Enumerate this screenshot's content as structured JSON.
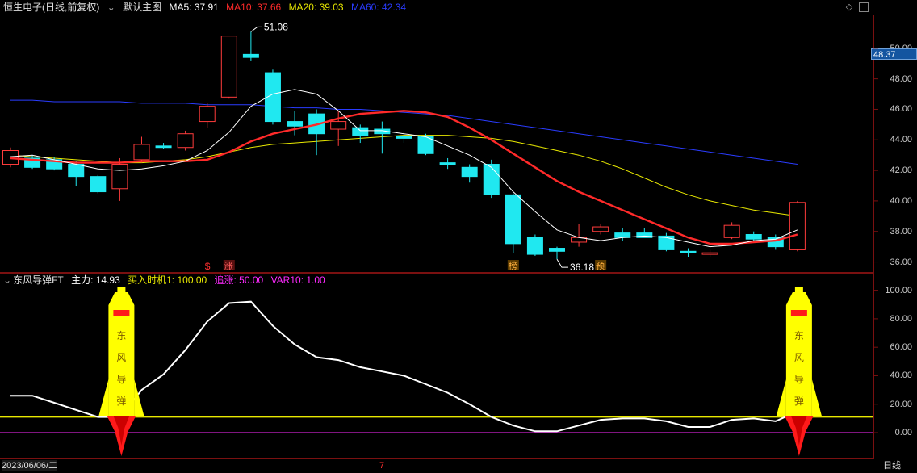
{
  "header_top": {
    "stock": "恒生电子",
    "period": "(日线,前复权)",
    "dropdown_icon": "chevron-down-icon",
    "template": "默认主图",
    "ma5": "MA5: 37.91",
    "ma10": "MA10: 37.66",
    "ma20": "MA20: 39.03",
    "ma60": "MA60: 42.34",
    "colors": {
      "stock": "#e0e0e0",
      "ma5": "#ffffff",
      "ma10": "#ff2a2a",
      "ma20": "#e8e800",
      "ma60": "#2a3cff"
    }
  },
  "header_bottom": {
    "indicator": "东风导弹FT",
    "main_force": "主力: 14.93",
    "buy_timing": "买入时机1: 100.00",
    "chase": "追涨: 50.00",
    "var10": "VAR10: 1.00",
    "colors": {
      "main_force": "#ffffff",
      "buy_timing": "#e8e800",
      "chase": "#ff2aff",
      "var10": "#ff2aff"
    }
  },
  "footer": {
    "date": "2023/06/06/二",
    "mark": "7",
    "period": "日线"
  },
  "last_price": "48.37",
  "chart_data": [
    {
      "type": "candlestick",
      "title": "恒生电子 (日线,前复权)",
      "ylim": [
        35.5,
        52
      ],
      "yticks": [
        "36.00",
        "38.00",
        "40.00",
        "42.00",
        "44.00",
        "46.00",
        "48.00",
        "50.00"
      ],
      "candles": [
        {
          "o": 42.4,
          "h": 43.5,
          "l": 42.2,
          "c": 43.3
        },
        {
          "o": 42.8,
          "h": 43.0,
          "l": 42.1,
          "c": 42.2
        },
        {
          "o": 42.7,
          "h": 42.9,
          "l": 42.0,
          "c": 42.1
        },
        {
          "o": 42.4,
          "h": 42.6,
          "l": 41.0,
          "c": 41.6
        },
        {
          "o": 41.6,
          "h": 41.7,
          "l": 40.5,
          "c": 40.6
        },
        {
          "o": 40.8,
          "h": 42.8,
          "l": 40.0,
          "c": 42.4
        },
        {
          "o": 42.7,
          "h": 44.2,
          "l": 42.5,
          "c": 43.7
        },
        {
          "o": 43.6,
          "h": 43.8,
          "l": 43.4,
          "c": 43.5
        },
        {
          "o": 43.5,
          "h": 44.6,
          "l": 43.3,
          "c": 44.4
        },
        {
          "o": 45.2,
          "h": 46.4,
          "l": 44.8,
          "c": 46.2
        },
        {
          "o": 46.8,
          "h": 50.8,
          "l": 46.7,
          "c": 50.8
        },
        {
          "o": 49.6,
          "h": 51.08,
          "l": 49.2,
          "c": 49.4
        },
        {
          "o": 48.4,
          "h": 48.6,
          "l": 45.0,
          "c": 45.2
        },
        {
          "o": 45.2,
          "h": 45.9,
          "l": 44.3,
          "c": 44.9
        },
        {
          "o": 45.7,
          "h": 46.0,
          "l": 43.0,
          "c": 44.4
        },
        {
          "o": 44.7,
          "h": 45.9,
          "l": 43.6,
          "c": 45.2
        },
        {
          "o": 44.8,
          "h": 45.0,
          "l": 43.8,
          "c": 44.3
        },
        {
          "o": 44.7,
          "h": 45.2,
          "l": 43.1,
          "c": 44.4
        },
        {
          "o": 44.2,
          "h": 44.5,
          "l": 43.8,
          "c": 44.1
        },
        {
          "o": 44.2,
          "h": 44.4,
          "l": 43.0,
          "c": 43.1
        },
        {
          "o": 42.5,
          "h": 42.8,
          "l": 42.1,
          "c": 42.4
        },
        {
          "o": 42.2,
          "h": 42.4,
          "l": 41.2,
          "c": 41.6
        },
        {
          "o": 42.4,
          "h": 42.7,
          "l": 40.2,
          "c": 40.4
        },
        {
          "o": 40.4,
          "h": 40.5,
          "l": 36.6,
          "c": 37.2
        },
        {
          "o": 37.6,
          "h": 37.8,
          "l": 36.4,
          "c": 36.5
        },
        {
          "o": 36.9,
          "h": 37.0,
          "l": 36.18,
          "c": 36.7
        },
        {
          "o": 37.3,
          "h": 38.5,
          "l": 37.0,
          "c": 37.6
        },
        {
          "o": 38.0,
          "h": 38.5,
          "l": 37.8,
          "c": 38.3
        },
        {
          "o": 37.9,
          "h": 38.2,
          "l": 37.4,
          "c": 37.6
        },
        {
          "o": 37.9,
          "h": 38.2,
          "l": 37.6,
          "c": 37.6
        },
        {
          "o": 37.7,
          "h": 37.9,
          "l": 36.7,
          "c": 36.8
        },
        {
          "o": 36.7,
          "h": 36.9,
          "l": 36.3,
          "c": 36.6
        },
        {
          "o": 36.5,
          "h": 36.8,
          "l": 36.3,
          "c": 36.6
        },
        {
          "o": 37.6,
          "h": 38.6,
          "l": 37.5,
          "c": 38.4
        },
        {
          "o": 37.8,
          "h": 38.0,
          "l": 37.4,
          "c": 37.5
        },
        {
          "o": 37.6,
          "h": 37.8,
          "l": 36.8,
          "c": 37.0
        },
        {
          "o": 36.8,
          "h": 40.0,
          "l": 36.7,
          "c": 39.9
        }
      ],
      "series": [
        {
          "name": "MA5",
          "color": "#ffffff",
          "values": [
            42.9,
            43.0,
            42.7,
            42.4,
            42.1,
            42.0,
            42.1,
            42.3,
            42.6,
            43.3,
            44.5,
            46.2,
            47.0,
            47.3,
            47.0,
            45.9,
            44.6,
            44.6,
            44.4,
            44.2,
            43.6,
            43.0,
            42.2,
            40.6,
            39.3,
            38.1,
            37.6,
            37.4,
            37.6,
            37.7,
            37.6,
            37.3,
            37.0,
            37.1,
            37.4,
            37.5,
            38.1
          ]
        },
        {
          "name": "MA10",
          "color": "#ff2a2a",
          "values": [
            42.8,
            42.7,
            42.6,
            42.5,
            42.5,
            42.5,
            42.6,
            42.6,
            42.6,
            42.7,
            43.2,
            43.9,
            44.4,
            44.7,
            45.0,
            45.4,
            45.7,
            45.8,
            45.9,
            45.8,
            45.5,
            44.8,
            44.0,
            43.1,
            42.2,
            41.3,
            40.6,
            40.0,
            39.4,
            38.8,
            38.2,
            37.6,
            37.2,
            37.2,
            37.3,
            37.4,
            37.8
          ]
        },
        {
          "name": "MA20",
          "color": "#e8e800",
          "values": [
            43.0,
            42.9,
            42.8,
            42.7,
            42.6,
            42.5,
            42.5,
            42.6,
            42.7,
            42.9,
            43.2,
            43.5,
            43.7,
            43.8,
            43.9,
            44.0,
            44.1,
            44.2,
            44.3,
            44.3,
            44.3,
            44.2,
            44.1,
            43.9,
            43.6,
            43.3,
            43.0,
            42.6,
            42.1,
            41.5,
            40.9,
            40.4,
            40.0,
            39.7,
            39.4,
            39.2,
            39.0
          ]
        },
        {
          "name": "MA60",
          "color": "#2a3cff",
          "values": [
            46.6,
            46.6,
            46.5,
            46.5,
            46.5,
            46.5,
            46.4,
            46.4,
            46.4,
            46.3,
            46.3,
            46.3,
            46.2,
            46.1,
            46.1,
            46.0,
            46.0,
            45.9,
            45.8,
            45.7,
            45.6,
            45.4,
            45.2,
            45.0,
            44.8,
            44.6,
            44.4,
            44.2,
            44.0,
            43.8,
            43.6,
            43.4,
            43.2,
            43.0,
            42.8,
            42.6,
            42.4
          ]
        }
      ],
      "annotations": [
        {
          "idx": 11,
          "value": 51.08,
          "label": "51.08",
          "kind": "high"
        },
        {
          "idx": 25,
          "value": 36.18,
          "label": "36.18",
          "kind": "low"
        }
      ],
      "markers": [
        {
          "idx": 9,
          "label": "$"
        },
        {
          "idx": 10,
          "label": "涨"
        },
        {
          "idx": 23,
          "label": "榜"
        },
        {
          "idx": 27,
          "label": "预"
        }
      ]
    },
    {
      "type": "line",
      "title": "东风导弹FT",
      "ylim": [
        -17,
        110
      ],
      "yticks": [
        "0.00",
        "20.00",
        "40.00",
        "60.00",
        "80.00",
        "100.00"
      ],
      "series": [
        {
          "name": "主力",
          "color": "#ffffff",
          "values": [
            26,
            26,
            21,
            16,
            11,
            11,
            30,
            41,
            58,
            78,
            91,
            92,
            75,
            62,
            53,
            51,
            46,
            43,
            40,
            34,
            28,
            20,
            11,
            5,
            1,
            1,
            5,
            9,
            10,
            10,
            8,
            4,
            4,
            9,
            10,
            8,
            14.93
          ]
        },
        {
          "name": "买入时机1",
          "color": "#e8e800",
          "constant": 11
        },
        {
          "name": "VAR10",
          "color": "#ff2aff",
          "constant": 0
        }
      ],
      "signals": [
        {
          "idx": 5,
          "text": [
            "东",
            "风",
            "导",
            "弹"
          ]
        },
        {
          "idx": 36,
          "text": [
            "东",
            "风",
            "导",
            "弹"
          ]
        }
      ]
    }
  ]
}
